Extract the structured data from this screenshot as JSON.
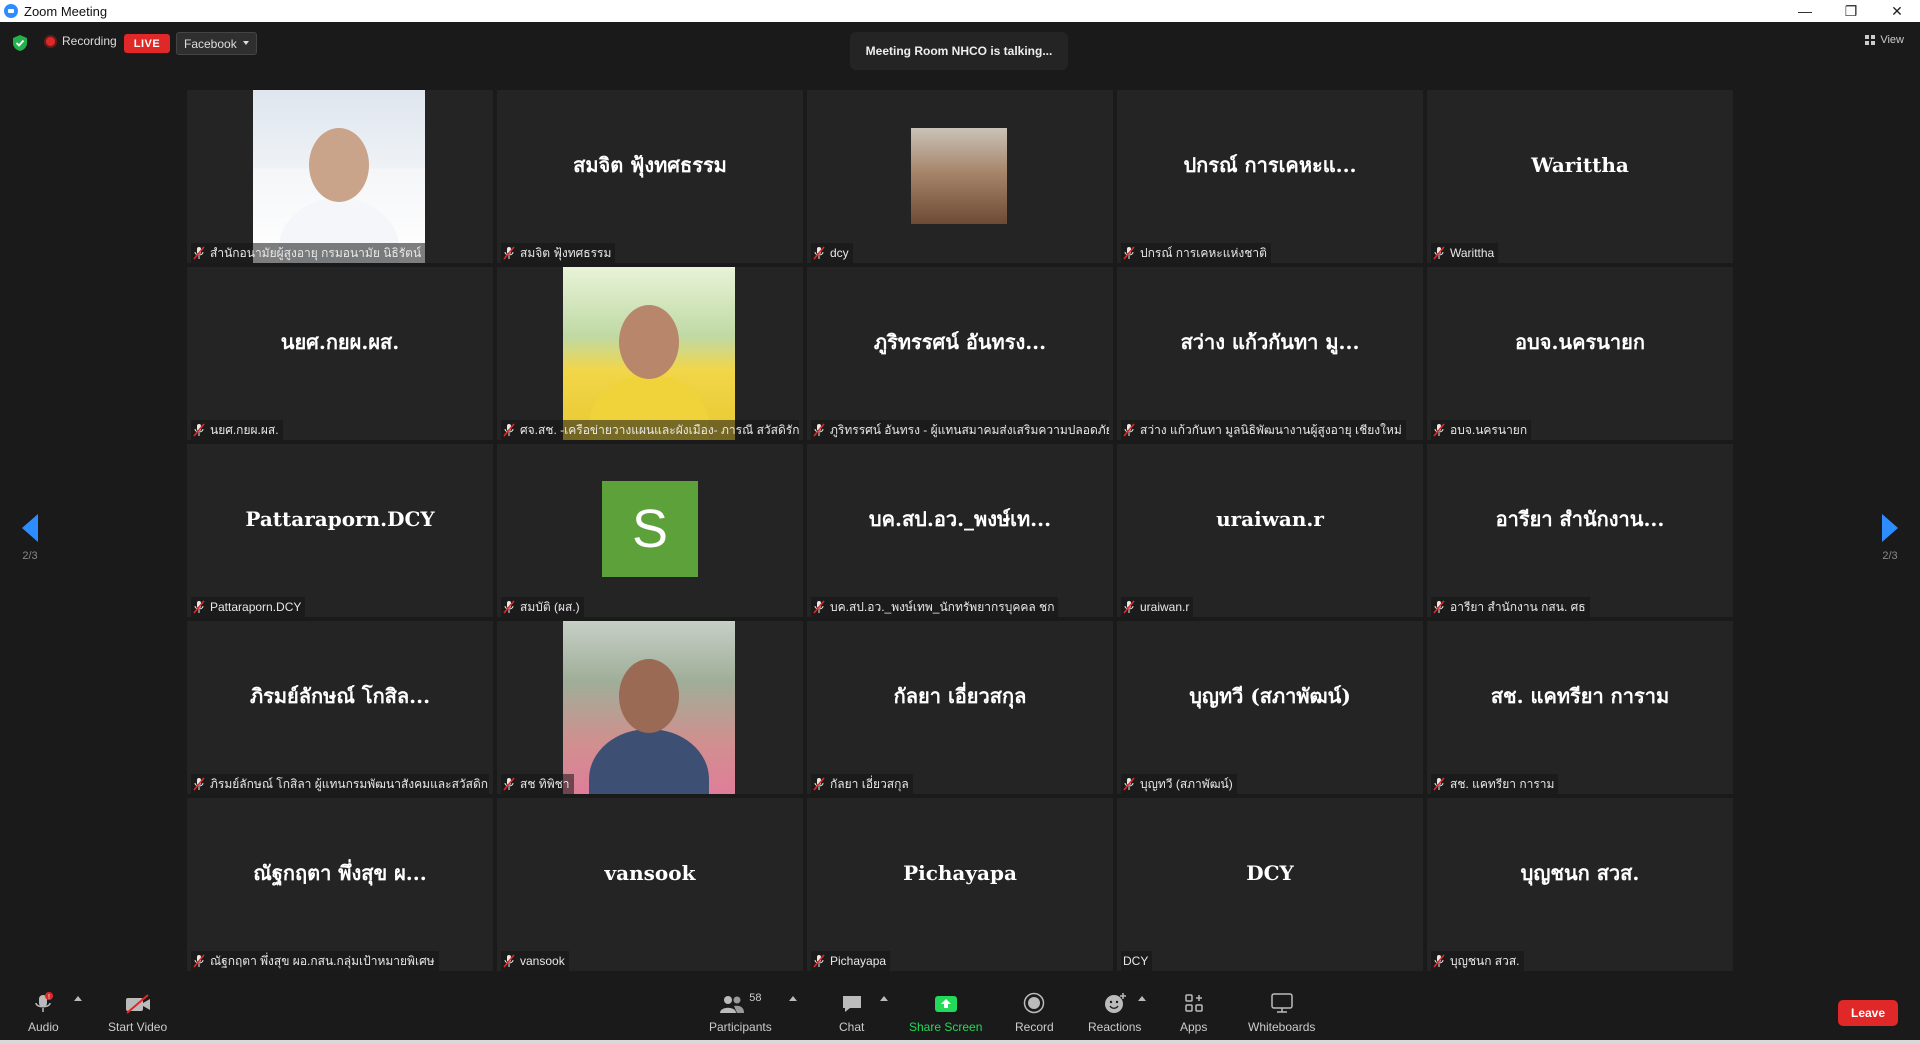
{
  "window": {
    "title": "Zoom Meeting",
    "minimize": "—",
    "restore": "❐",
    "close": "✕"
  },
  "topbar": {
    "recording_label": "Recording",
    "live_label": "LIVE",
    "stream_target": "Facebook",
    "talking_text": "Meeting Room NHCO is talking...",
    "view_label": "View"
  },
  "pagination": {
    "left": "2/3",
    "right": "2/3"
  },
  "tiles": [
    {
      "display": "video",
      "label": "สำนักอนามัยผู้สูงอายุ กรมอนามัย นิธิรัตน์"
    },
    {
      "display": "name",
      "center": "สมจิต ฟุ้งทศธรรม",
      "label": "สมจิต ฟุ้งทศธรรม"
    },
    {
      "display": "photo",
      "label": "dcy"
    },
    {
      "display": "name",
      "center": "ปกรณ์ การเคหะแ...",
      "label": "ปกรณ์ การเคหะแห่งชาติ"
    },
    {
      "display": "name",
      "center": "Warittha",
      "label": "Warittha"
    },
    {
      "display": "name",
      "center": "นยศ.กยผ.ผส.",
      "label": "นยศ.กยผ.ผส."
    },
    {
      "display": "video",
      "label": "ศจ.สช. -เครือข่ายวางแผนและผังเมือง- ภารณี สวัสดิรักษ์"
    },
    {
      "display": "name",
      "center": "ภูริทรรศน์ อันทรง...",
      "label": "ภูริทรรศน์ อันทรง - ผู้แทนสมาคมส่งเสริมความปลอดภัยฯ"
    },
    {
      "display": "name",
      "center": "สว่าง แก้วกันทา มู...",
      "label": "สว่าง แก้วกันทา มูลนิธิพัฒนางานผู้สูงอายุ เชียงใหม่"
    },
    {
      "display": "name",
      "center": "อบจ.นครนายก",
      "label": "อบจ.นครนายก"
    },
    {
      "display": "name",
      "center": "Pattaraporn.DCY",
      "label": "Pattaraporn.DCY"
    },
    {
      "display": "avatar",
      "initial": "S",
      "label": "สมบัติ (ผส.)"
    },
    {
      "display": "name",
      "center": "บค.สป.อว._พงษ์เท...",
      "label": "บค.สป.อว._พงษ์เทพ_นักทรัพยากรบุคคล ชก"
    },
    {
      "display": "name",
      "center": "uraiwan.r",
      "label": "uraiwan.r"
    },
    {
      "display": "name",
      "center": "อารียา สำนักงาน...",
      "label": "อารียา สำนักงาน กสน. ศธ"
    },
    {
      "display": "name",
      "center": "ภิรมย์ลักษณ์ โกสิล...",
      "label": "ภิรมย์ลักษณ์ โกสิลา ผู้แทนกรมพัฒนาสังคมและสวัสดิกา..."
    },
    {
      "display": "video",
      "label": "สช ทิพิชา"
    },
    {
      "display": "name",
      "center": "กัลยา เอี่ยวสกุล",
      "label": "กัลยา เอี่ยวสกุล"
    },
    {
      "display": "name",
      "center": "บุญทวี (สภาพัฒน์)",
      "label": "บุญทวี (สภาพัฒน์)"
    },
    {
      "display": "name",
      "center": "สช. แคทรียา การาม",
      "label": "สช. แคทรียา การาม"
    },
    {
      "display": "name",
      "center": "ณัฐกฤตา พึ่งสุข ผ...",
      "label": "ณัฐกฤตา พึ่งสุข ผอ.กสน.กลุ่มเป้าหมายพิเศษ"
    },
    {
      "display": "name",
      "center": "vansook",
      "label": "vansook"
    },
    {
      "display": "name",
      "center": "Pichayapa",
      "label": "Pichayapa"
    },
    {
      "display": "name",
      "center": "DCY",
      "label": "DCY",
      "unmuted": true
    },
    {
      "display": "name",
      "center": "บุญชนก สวส.",
      "label": "บุญชนก สวส."
    }
  ],
  "toolbar": {
    "audio": "Audio",
    "audio_badge": "!",
    "start_video": "Start Video",
    "participants": "Participants",
    "participants_count": "58",
    "chat": "Chat",
    "share_screen": "Share Screen",
    "record": "Record",
    "reactions": "Reactions",
    "apps": "Apps",
    "whiteboards": "Whiteboards",
    "leave": "Leave"
  },
  "colors": {
    "accent": "#2d8cff",
    "live": "#e02828",
    "share": "#23d959",
    "tile": "#242424",
    "bg": "#1a1a1a"
  }
}
